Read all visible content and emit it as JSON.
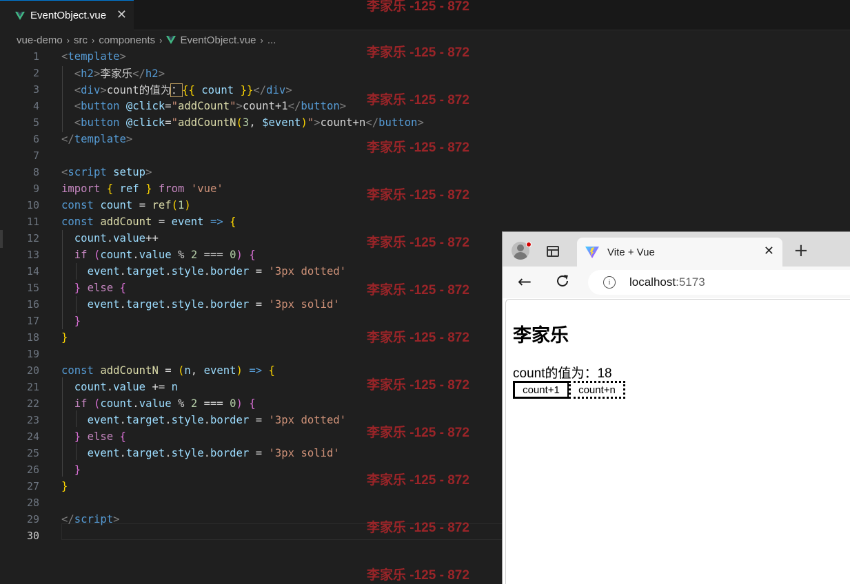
{
  "editor": {
    "tab": {
      "label": "EventObject.vue",
      "close": "✕"
    },
    "breadcrumb": [
      "vue-demo",
      "src",
      "components",
      "EventObject.vue",
      "..."
    ],
    "current_line": 30
  },
  "watermark": "李家乐 -125 - 872",
  "browser": {
    "tab_title": "Vite + Vue",
    "tab_close": "✕",
    "new_tab": "+",
    "address_host": "localhost",
    "address_port": ":5173",
    "page": {
      "heading": "李家乐",
      "count_text": "count的值为：18",
      "button1": "count+1",
      "button2": "count+n"
    }
  },
  "colors": {
    "accent": "#0078d4",
    "watermark": "#b0262a",
    "vue_green": "#41b883"
  }
}
